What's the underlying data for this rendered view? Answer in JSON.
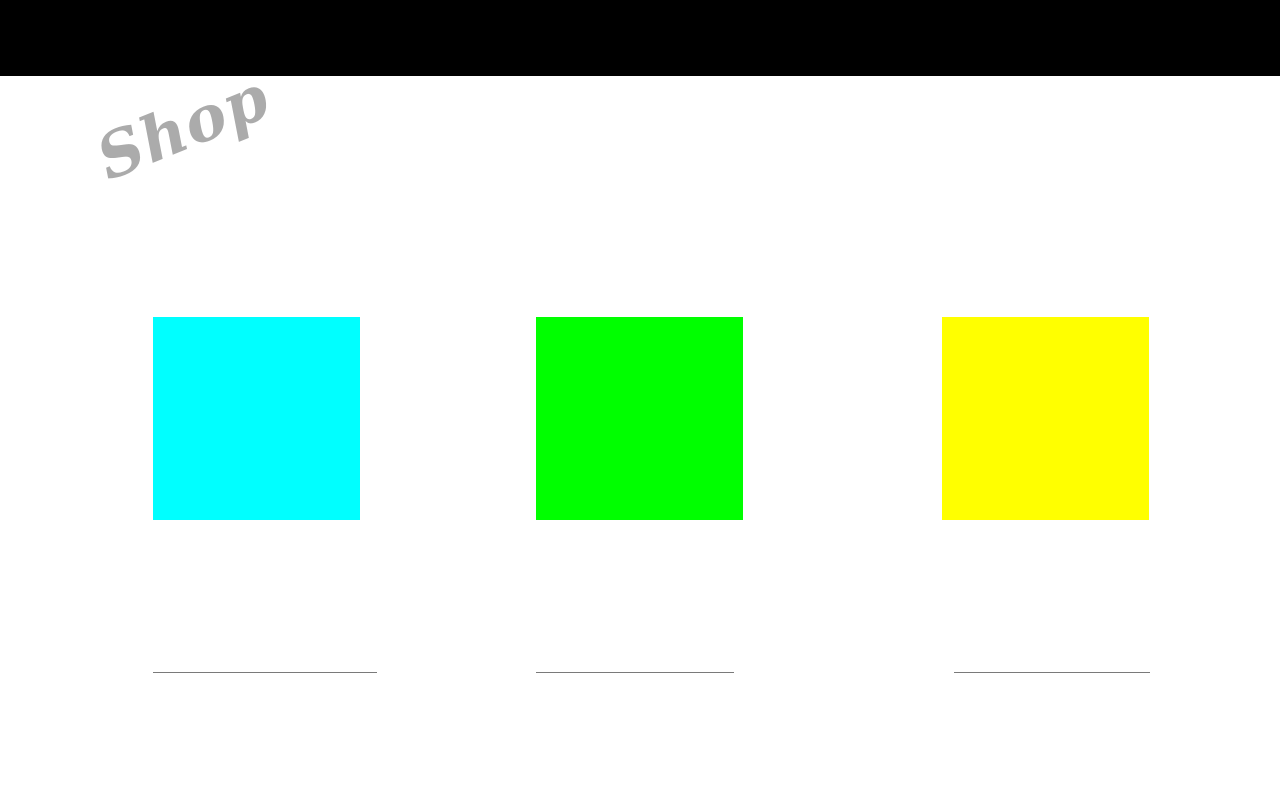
{
  "header": {
    "bar_color": "#000000"
  },
  "page": {
    "title": "Shop",
    "title_color": "#ababab"
  },
  "products": [
    {
      "image_color": "#00ffff"
    },
    {
      "image_color": "#00ff00"
    },
    {
      "image_color": "#ffff00"
    }
  ]
}
